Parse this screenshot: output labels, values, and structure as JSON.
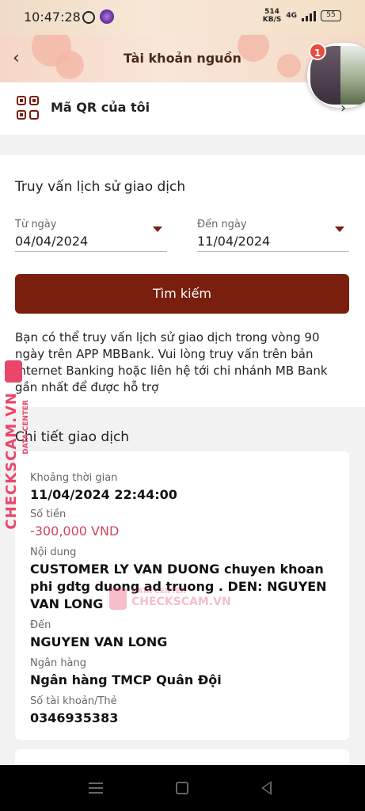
{
  "status_bar": {
    "time": "10:47:28",
    "net_speed_value": "514",
    "net_speed_unit": "KB/S",
    "network": "4G",
    "battery": "55"
  },
  "header": {
    "title": "Tài khoản nguồn",
    "notification_count": "1"
  },
  "qr": {
    "label": "Mã QR của tôi"
  },
  "search": {
    "title": "Truy vấn lịch sử giao dịch",
    "from_label": "Từ ngày",
    "from_value": "04/04/2024",
    "to_label": "Đến ngày",
    "to_value": "11/04/2024",
    "button_label": "Tìm kiếm",
    "note": "Bạn có thể truy vấn lịch sử giao dịch trong vòng 90 ngày trên APP MBBank. Vui lòng truy vấn trên bản Internet Banking hoặc liên hệ tới chi nhánh MB Bank gần nhất để được hỗ trợ"
  },
  "detail": {
    "title": "Chi tiết giao dịch",
    "time_label": "Khoảng thời gian",
    "time_value": "11/04/2024 22:44:00",
    "amount_label": "Số tiền",
    "amount_value": "-300,000 VND",
    "content_label": "Nội dung",
    "content_value": "CUSTOMER LY VAN DUONG chuyen khoan phi gdtg  duong ad truong  . DEN: NGUYEN VAN LONG",
    "to_label": "Đến",
    "to_value": "NGUYEN VAN LONG",
    "bank_label": "Ngân hàng",
    "bank_value": "Ngân hàng TMCP Quân Đội",
    "account_label": "Số tài khoản/Thẻ",
    "account_value": "0346935383"
  },
  "watermark": {
    "brand": "CHECKSCAM.VN",
    "sub": "DATA CENTER"
  },
  "colors": {
    "primary": "#7a1e0e",
    "negative_amount": "#d0455a",
    "watermark": "#e8476a"
  }
}
